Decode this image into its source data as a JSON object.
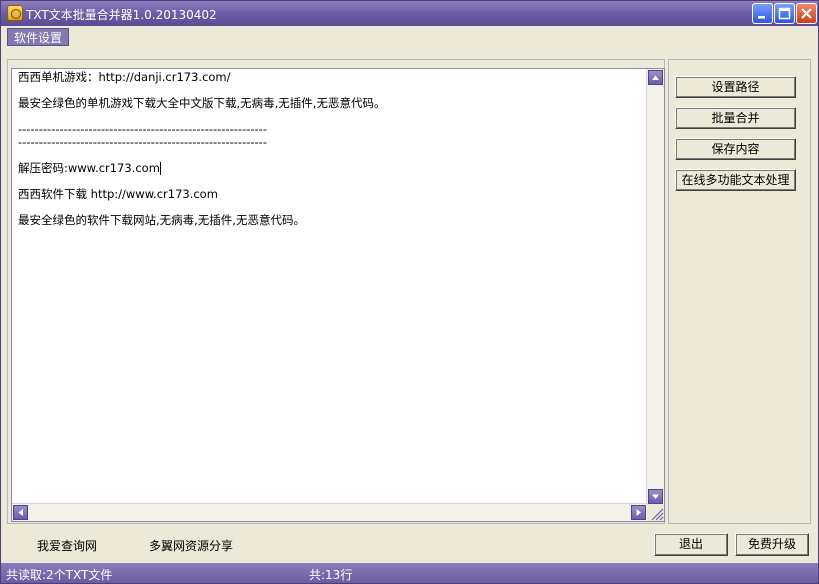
{
  "window": {
    "title": "TXT文本批量合并器1.0.20130402"
  },
  "menu": {
    "settings_label": "软件设置"
  },
  "editor": {
    "lines": [
      "西西单机游戏：http://danji.cr173.com/",
      "最安全绿色的单机游戏下载大全中文版下载,无病毒,无插件,无恶意代码。",
      "------------------------------------------------------------",
      "------------------------------------------------------------",
      "解压密码:www.cr173.com",
      "西西软件下载 http://www.cr173.com",
      "最安全绿色的软件下载网站,无病毒,无插件,无恶意代码。"
    ]
  },
  "side_buttons": {
    "set_path": "设置路径",
    "batch_merge": "批量合并",
    "save_content": "保存内容",
    "online_text": "在线多功能文本处理"
  },
  "links": {
    "query_site": "我爱查询网",
    "share_site": "多翼网资源分享"
  },
  "bottom_buttons": {
    "exit": "退出",
    "upgrade": "免费升级"
  },
  "status": {
    "files_read": "共读取:2个TXT文件",
    "line_count": "共:13行"
  },
  "colors": {
    "titlebar": "#6f5fa8",
    "statusbar": "#7a6cb0",
    "menu_item": "#8378b0"
  }
}
